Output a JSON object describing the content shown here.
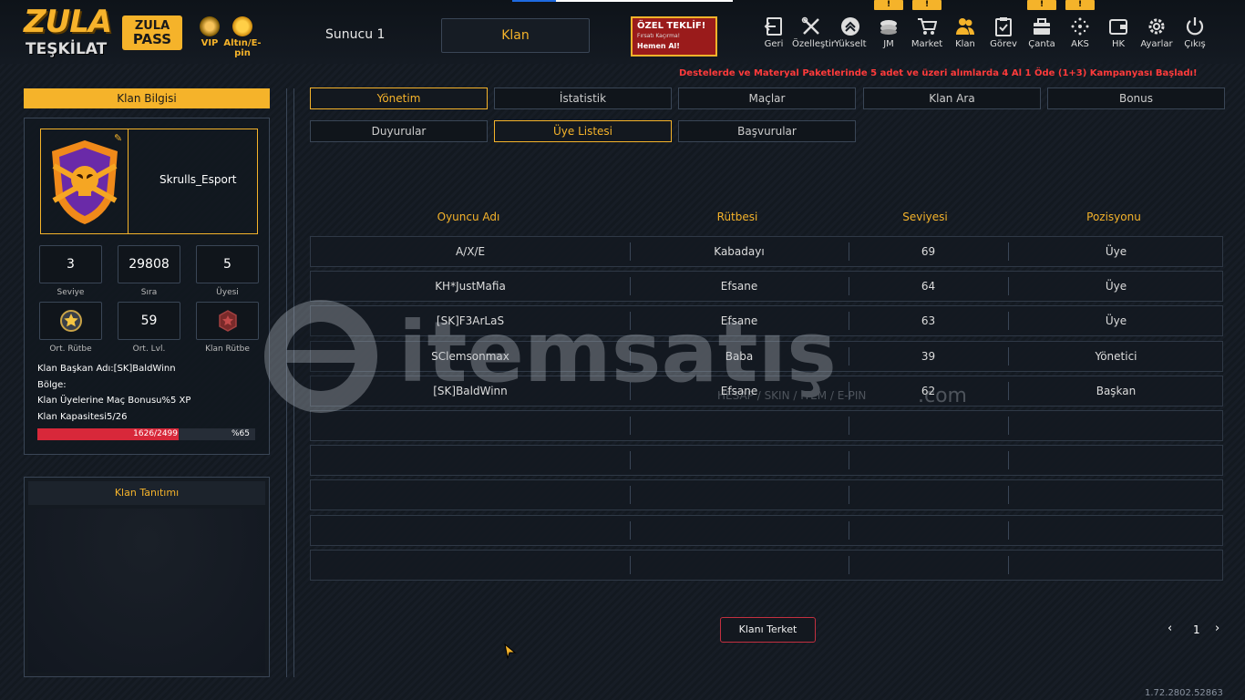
{
  "logo": {
    "line1": "ZULA",
    "line2": "TEŞKİLAT"
  },
  "pass": {
    "line1": "ZULA",
    "line2": "PASS"
  },
  "vip": {
    "label": "VIP"
  },
  "epin": {
    "label": "Altın/E-pin"
  },
  "server": {
    "label": "Sunucu 1"
  },
  "section": {
    "label": "Klan"
  },
  "offer": {
    "title": "ÖZEL TEKLİF!",
    "sub": "Fırsatı Kaçırma!",
    "cta": "Hemen Al!"
  },
  "nav": [
    {
      "label": "Geri",
      "icon": "back-icon"
    },
    {
      "label": "Özelleştir",
      "icon": "tools-icon"
    },
    {
      "label": "Yükselt",
      "icon": "upgrade-icon"
    },
    {
      "label": "JM",
      "icon": "coins-icon"
    },
    {
      "label": "Market",
      "icon": "cart-icon"
    },
    {
      "label": "Klan",
      "icon": "clan-icon"
    },
    {
      "label": "Görev",
      "icon": "task-icon"
    },
    {
      "label": "Çanta",
      "icon": "bag-icon"
    },
    {
      "label": "AKS",
      "icon": "aks-icon"
    },
    {
      "label": "HK",
      "icon": "wallet-icon"
    },
    {
      "label": "Ayarlar",
      "icon": "gear-icon"
    },
    {
      "label": "Çıkış",
      "icon": "power-icon"
    }
  ],
  "badges": [
    "!",
    "!",
    "!",
    "!"
  ],
  "announcement": "Destelerde ve Materyal Paketlerinde 5 adet ve üzeri alımlarda 4 Al 1 Öde (1+3) Kampanyası Başladı!",
  "sidebar": {
    "header": "Klan Bilgisi",
    "clan_name": "Skrulls_Esport",
    "stats": [
      {
        "value": "3",
        "label": "Seviye"
      },
      {
        "value": "29808",
        "label": "Sıra"
      },
      {
        "value": "5",
        "label": "Üyesi"
      }
    ],
    "stats2": [
      {
        "value": "",
        "label": "Ort. Rütbe"
      },
      {
        "value": "59",
        "label": "Ort. Lvl."
      },
      {
        "value": "",
        "label": "Klan Rütbe"
      }
    ],
    "leader": "Klan Başkan Adı:[SK]BaldWinn",
    "region": "Bölge:",
    "bonus": "Klan Üyelerine Maç Bonusu%5 XP",
    "capacity": "Klan Kapasitesi5/26",
    "xp_text": "1626/2499",
    "xp_percent": "%65",
    "xp_fill": 0.65
  },
  "description": {
    "header": "Klan Tanıtımı"
  },
  "tabs_row1": [
    "Yönetim",
    "İstatistik",
    "Maçlar",
    "Klan Ara",
    "Bonus"
  ],
  "tabs_row2": [
    "Duyurular",
    "Üye Listesi",
    "Başvurular"
  ],
  "table": {
    "headers": [
      "Oyuncu Adı",
      "Rütbesi",
      "Seviyesi",
      "Pozisyonu"
    ],
    "rows": [
      [
        "A/X/E",
        "Kabadayı",
        "69",
        "Üye"
      ],
      [
        "KH*JustMafia",
        "Efsane",
        "64",
        "Üye"
      ],
      [
        "[SK]F3ArLaS",
        "Efsane",
        "63",
        "Üye"
      ],
      [
        "SClemsonmax",
        "Baba",
        "39",
        "Yönetici"
      ],
      [
        "[SK]BaldWinn",
        "Efsane",
        "62",
        "Başkan"
      ],
      [
        "",
        "",
        "",
        ""
      ],
      [
        "",
        "",
        "",
        ""
      ],
      [
        "",
        "",
        "",
        ""
      ],
      [
        "",
        "",
        "",
        ""
      ],
      [
        "",
        "",
        "",
        ""
      ]
    ]
  },
  "leave_button": "Klanı Terket",
  "pagination": {
    "page": "1",
    "prev": "‹",
    "next": "›"
  },
  "version": "1.72.2802.52863",
  "watermark": {
    "brand": "itemsatış",
    "tag": "HESAP / SKIN / ITEM / E-PIN",
    "com": ".com"
  }
}
